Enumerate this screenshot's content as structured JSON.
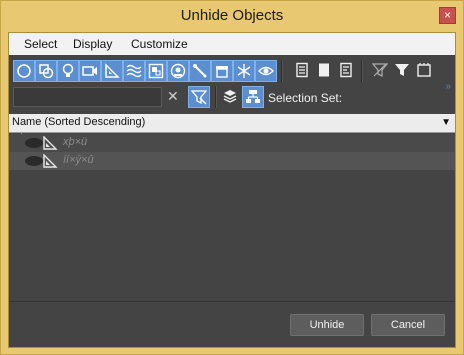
{
  "window": {
    "title": "Unhide Objects",
    "close_glyph": "×"
  },
  "menu": {
    "items": [
      "Select",
      "Display",
      "Customize"
    ]
  },
  "toolbar": {
    "filter_icons": [
      "geometry-icon",
      "shapes-icon",
      "lights-icon",
      "cameras-icon",
      "helpers-icon",
      "spacewarps-icon",
      "groups-icon",
      "xrefs-icon",
      "bones-icon",
      "containers-icon",
      "frozen-icon",
      "hidden-icon"
    ],
    "list_icons": [
      "list-all-icon",
      "list-none-icon",
      "list-invert-icon"
    ],
    "filter_right_icons": [
      "filter-off-icon",
      "filter-icon",
      "clipboard-icon"
    ]
  },
  "search": {
    "value": "",
    "clear_glyph": "✕"
  },
  "selection_set": {
    "label": "Selection Set:"
  },
  "list": {
    "header": "Name (Sorted Descending)",
    "rows": [
      {
        "name": "xþ×ü"
      },
      {
        "name": "íí×ý×û"
      }
    ]
  },
  "buttons": {
    "unhide": "Unhide",
    "cancel": "Cancel"
  },
  "colors": {
    "accent": "#5b8fcf",
    "title_bar": "#e8c971",
    "panel": "#444444"
  }
}
